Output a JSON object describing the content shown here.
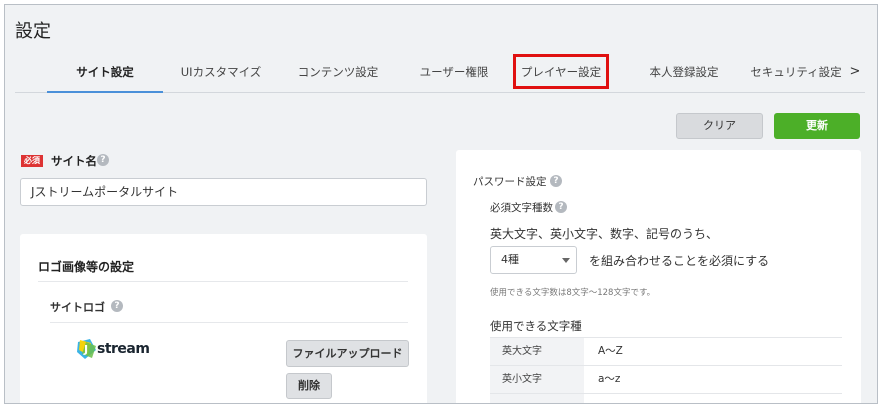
{
  "header": {
    "title": "設定"
  },
  "tabs": [
    {
      "label": "サイト設定",
      "active": true
    },
    {
      "label": "UIカスタマイズ",
      "active": false
    },
    {
      "label": "コンテンツ設定",
      "active": false
    },
    {
      "label": "ユーザー権限",
      "active": false
    },
    {
      "label": "プレイヤー設定",
      "active": false,
      "highlighted": true
    },
    {
      "label": "本人登録設定",
      "active": false
    },
    {
      "label": "セキュリティ設定",
      "active": false
    }
  ],
  "tabs_next_icon": ">",
  "actions": {
    "clear_label": "クリア",
    "update_label": "更新"
  },
  "site_name": {
    "required_badge": "必須",
    "label": "サイト名",
    "value": "Jストリームポータルサイト"
  },
  "logo_section": {
    "heading": "ロゴ画像等の設定",
    "site_logo_label": "サイトロゴ",
    "logo_text": "stream",
    "upload_label": "ファイルアップロード",
    "delete_label": "削除"
  },
  "password": {
    "heading": "パスワード設定",
    "required_types_label": "必須文字種数",
    "description": "英大文字、英小文字、数字、記号のうち、",
    "select_value": "4種",
    "suffix": "を組み合わせることを必須にする",
    "hint": "使用できる文字数は8文字〜128文字です。",
    "usable_heading": "使用できる文字種",
    "char_types": [
      {
        "name": "英大文字",
        "range": "A〜Z"
      },
      {
        "name": "英小文字",
        "range": "a〜z"
      }
    ]
  },
  "colors": {
    "accent": "#4a90d9",
    "update_button": "#4caf28",
    "required_badge": "#dd3333",
    "highlight_box": "#e01010"
  }
}
